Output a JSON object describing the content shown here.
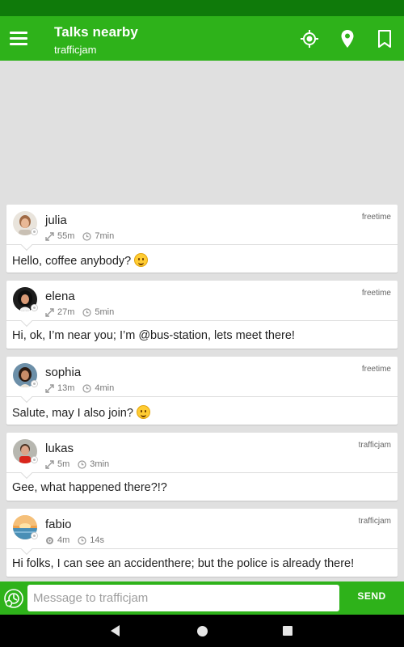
{
  "app_bar": {
    "title": "Talks nearby",
    "subtitle": "trafficjam",
    "icons": [
      "menu-icon",
      "gps-target-icon",
      "location-pin-icon",
      "bookmark-icon"
    ]
  },
  "colors": {
    "status_bar": "#0f7a0a",
    "primary": "#2eb21a",
    "background": "#e0e0e0"
  },
  "messages": [
    {
      "name": "julia",
      "distance": "55m",
      "time": "7min",
      "tag": "freetime",
      "text": "Hello, coffee anybody?",
      "emoji": "smile"
    },
    {
      "name": "elena",
      "distance": "27m",
      "time": "5min",
      "tag": "freetime",
      "text": "Hi, ok, I’m near you; I’m @bus-station, lets meet there!",
      "emoji": ""
    },
    {
      "name": "sophia",
      "distance": "13m",
      "time": "4min",
      "tag": "freetime",
      "text": "Salute, may I also join?",
      "emoji": "grin"
    },
    {
      "name": "lukas",
      "distance": "5m",
      "time": "3min",
      "tag": "trafficjam",
      "text": "Gee, what happened there?!?",
      "emoji": ""
    },
    {
      "name": "fabio",
      "distance": "4m",
      "time": "14s",
      "tag": "trafficjam",
      "text": "Hi folks, I can see an accidenthere; but the police is already there!",
      "emoji": ""
    }
  ],
  "composer": {
    "placeholder": "Message to trafficjam",
    "value": "",
    "send_label": "SEND"
  },
  "nav": {
    "icons": [
      "back-icon",
      "home-icon",
      "recents-icon"
    ]
  }
}
